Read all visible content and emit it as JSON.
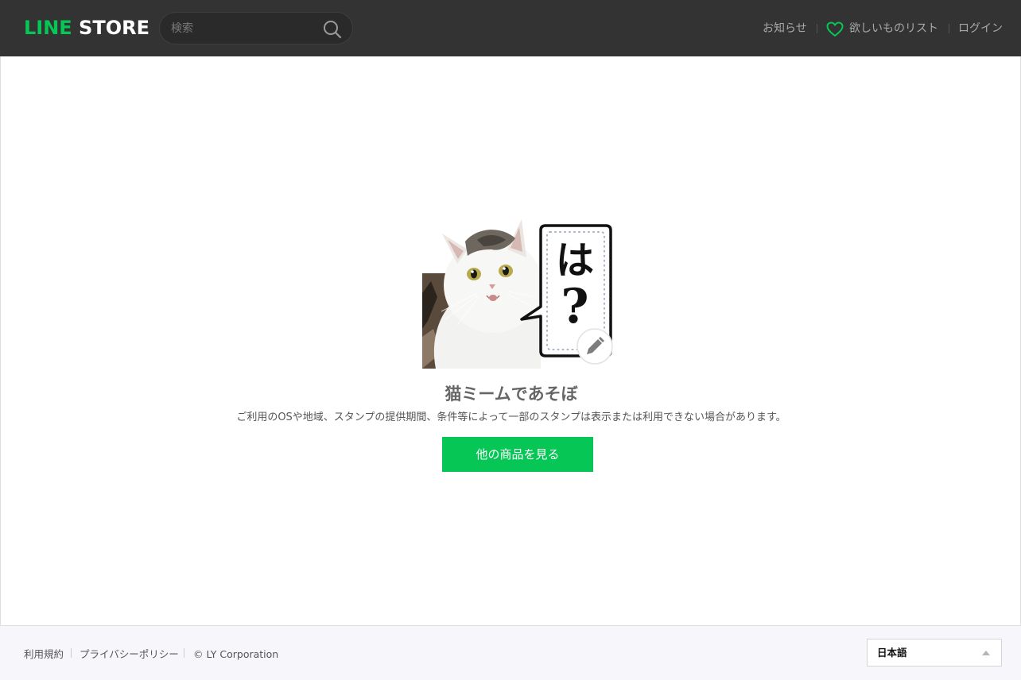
{
  "header": {
    "logo_line": "LINE",
    "logo_store": " STORE",
    "search_placeholder": "検索",
    "nav_news": "お知らせ",
    "nav_wishlist": "欲しいものリスト",
    "nav_login": "ログイン"
  },
  "main": {
    "sticker_bubble_text": "は？",
    "product_title": "猫ミームであそぼ",
    "notice": "ご利用のOSや地域、スタンプの提供期間、条件等によって一部のスタンプは表示または利用できない場合があります。",
    "cta_label": "他の商品を見る"
  },
  "footer": {
    "terms": "利用規約",
    "privacy": "プライバシーポリシー",
    "copyright": "© LY Corporation",
    "language": "日本語"
  },
  "colors": {
    "brand_green": "#06c755",
    "header_bg": "#333333",
    "footer_bg": "#f7f7fb"
  },
  "icons": [
    "search-icon",
    "heart-icon",
    "pencil-icon",
    "caret-up-icon"
  ]
}
